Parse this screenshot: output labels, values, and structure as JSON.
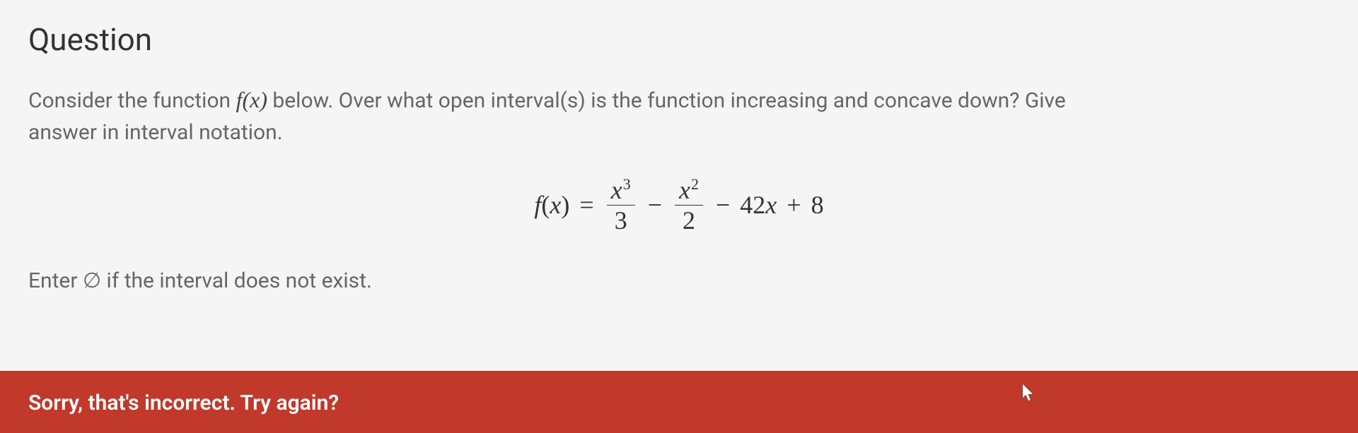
{
  "title": "Question",
  "prompt": {
    "part1": "Consider the function ",
    "fx": "f(x)",
    "part2": " below. Over what open interval(s) is the function increasing and concave down? Give ",
    "part3": "answer in interval notation."
  },
  "formula": {
    "lhs_func": "f",
    "lhs_arg": "x",
    "frac1_num_base": "x",
    "frac1_num_exp": "3",
    "frac1_den": "3",
    "frac2_num_base": "x",
    "frac2_num_exp": "2",
    "frac2_den": "2",
    "term3_coef": "42",
    "term3_var": "x",
    "constant": "8"
  },
  "instruction": {
    "part1": "Enter ",
    "symbol": "∅",
    "part2": " if the interval does not exist."
  },
  "error_message": "Sorry, that's incorrect. Try again?"
}
